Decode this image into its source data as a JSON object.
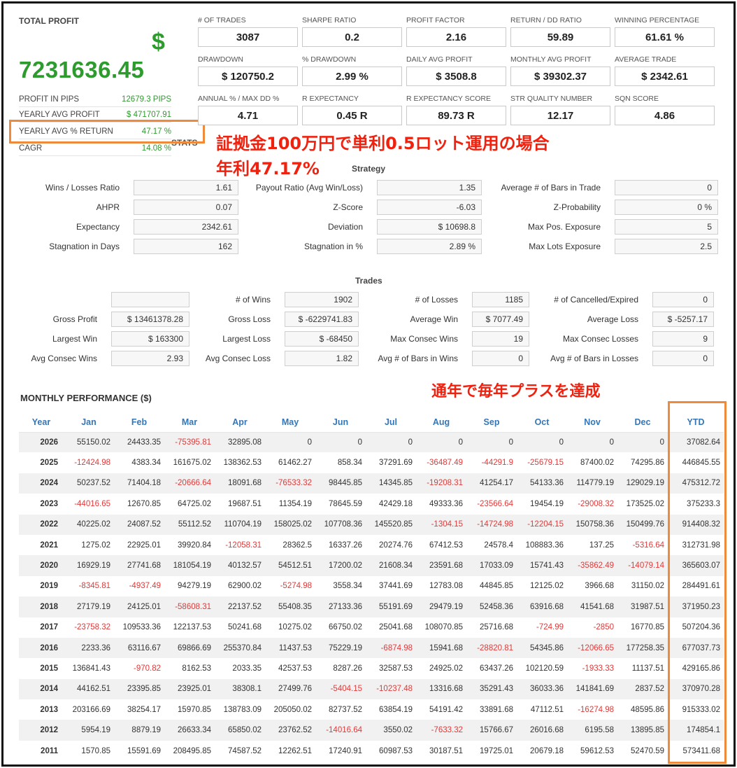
{
  "total_profit": {
    "title": "TOTAL PROFIT",
    "currency_symbol": "$",
    "value": "7231636.45",
    "rows": [
      {
        "label": "PROFIT IN PIPS",
        "value": "12679.3 PIPS"
      },
      {
        "label": "YEARLY AVG PROFIT",
        "value": "$ 471707.91"
      },
      {
        "label": "YEARLY AVG % RETURN",
        "value": "47.17 %"
      },
      {
        "label": "CAGR",
        "value": "14.08 %"
      }
    ]
  },
  "stats_grid": [
    {
      "label": "# OF TRADES",
      "value": "3087"
    },
    {
      "label": "SHARPE RATIO",
      "value": "0.2"
    },
    {
      "label": "PROFIT FACTOR",
      "value": "2.16"
    },
    {
      "label": "RETURN / DD RATIO",
      "value": "59.89"
    },
    {
      "label": "WINNING PERCENTAGE",
      "value": "61.61 %"
    },
    {
      "label": "DRAWDOWN",
      "value": "$ 120750.2"
    },
    {
      "label": "% DRAWDOWN",
      "value": "2.99 %"
    },
    {
      "label": "DAILY AVG PROFIT",
      "value": "$ 3508.8"
    },
    {
      "label": "MONTHLY AVG PROFIT",
      "value": "$ 39302.37"
    },
    {
      "label": "AVERAGE TRADE",
      "value": "$ 2342.61"
    },
    {
      "label": "ANNUAL % / MAX DD %",
      "value": "4.71"
    },
    {
      "label": "R EXPECTANCY",
      "value": "0.45 R"
    },
    {
      "label": "R EXPECTANCY SCORE",
      "value": "89.73 R"
    },
    {
      "label": "STR QUALITY NUMBER",
      "value": "12.17"
    },
    {
      "label": "SQN SCORE",
      "value": "4.86"
    }
  ],
  "annotations": {
    "line1": "証拠金100万円で単利0.5ロット運用の場合",
    "line2": "年利47.17%",
    "monthly_note": "通年で毎年プラスを達成",
    "stats_fragment": "STATS"
  },
  "strategy": {
    "title": "Strategy",
    "rows": [
      [
        {
          "label": "Wins / Losses Ratio",
          "value": "1.61"
        },
        {
          "label": "Payout Ratio (Avg Win/Loss)",
          "value": "1.35"
        },
        {
          "label": "Average # of Bars in Trade",
          "value": "0"
        }
      ],
      [
        {
          "label": "AHPR",
          "value": "0.07"
        },
        {
          "label": "Z-Score",
          "value": "-6.03"
        },
        {
          "label": "Z-Probability",
          "value": "0 %"
        }
      ],
      [
        {
          "label": "Expectancy",
          "value": "2342.61"
        },
        {
          "label": "Deviation",
          "value": "$ 10698.8"
        },
        {
          "label": "Max Pos. Exposure",
          "value": "5"
        }
      ],
      [
        {
          "label": "Stagnation in Days",
          "value": "162"
        },
        {
          "label": "Stagnation in %",
          "value": "2.89 %"
        },
        {
          "label": "Max Lots Exposure",
          "value": "2.5"
        }
      ]
    ]
  },
  "trades": {
    "title": "Trades",
    "rows": [
      [
        {
          "label": "",
          "value": ""
        },
        {
          "label": "# of Wins",
          "value": "1902"
        },
        {
          "label": "# of Losses",
          "value": "1185"
        },
        {
          "label": "# of Cancelled/Expired",
          "value": "0"
        }
      ],
      [
        {
          "label": "Gross Profit",
          "value": "$ 13461378.28"
        },
        {
          "label": "Gross Loss",
          "value": "$ -6229741.83"
        },
        {
          "label": "Average Win",
          "value": "$ 7077.49"
        },
        {
          "label": "Average Loss",
          "value": "$ -5257.17"
        }
      ],
      [
        {
          "label": "Largest Win",
          "value": "$ 163300"
        },
        {
          "label": "Largest Loss",
          "value": "$ -68450"
        },
        {
          "label": "Max Consec Wins",
          "value": "19"
        },
        {
          "label": "Max Consec Losses",
          "value": "9"
        }
      ],
      [
        {
          "label": "Avg Consec Wins",
          "value": "2.93"
        },
        {
          "label": "Avg Consec Loss",
          "value": "1.82"
        },
        {
          "label": "Avg # of Bars in Wins",
          "value": "0"
        },
        {
          "label": "Avg # of Bars in Losses",
          "value": "0"
        }
      ]
    ]
  },
  "monthly": {
    "title": "MONTHLY PERFORMANCE ($)",
    "headers": [
      "Year",
      "Jan",
      "Feb",
      "Mar",
      "Apr",
      "May",
      "Jun",
      "Jul",
      "Aug",
      "Sep",
      "Oct",
      "Nov",
      "Dec",
      "YTD"
    ],
    "rows": [
      [
        "2026",
        "55150.02",
        "24433.35",
        "-75395.81",
        "32895.08",
        "0",
        "0",
        "0",
        "0",
        "0",
        "0",
        "0",
        "0",
        "37082.64"
      ],
      [
        "2025",
        "-12424.98",
        "4383.34",
        "161675.02",
        "138362.53",
        "61462.27",
        "858.34",
        "37291.69",
        "-36487.49",
        "-44291.9",
        "-25679.15",
        "87400.02",
        "74295.86",
        "446845.55"
      ],
      [
        "2024",
        "50237.52",
        "71404.18",
        "-20666.64",
        "18091.68",
        "-76533.32",
        "98445.85",
        "14345.85",
        "-19208.31",
        "41254.17",
        "54133.36",
        "114779.19",
        "129029.19",
        "475312.72"
      ],
      [
        "2023",
        "-44016.65",
        "12670.85",
        "64725.02",
        "19687.51",
        "11354.19",
        "78645.59",
        "42429.18",
        "49333.36",
        "-23566.64",
        "19454.19",
        "-29008.32",
        "173525.02",
        "375233.3"
      ],
      [
        "2022",
        "40225.02",
        "24087.52",
        "55112.52",
        "110704.19",
        "158025.02",
        "107708.36",
        "145520.85",
        "-1304.15",
        "-14724.98",
        "-12204.15",
        "150758.36",
        "150499.76",
        "914408.32"
      ],
      [
        "2021",
        "1275.02",
        "22925.01",
        "39920.84",
        "-12058.31",
        "28362.5",
        "16337.26",
        "20274.76",
        "67412.53",
        "24578.4",
        "108883.36",
        "137.25",
        "-5316.64",
        "312731.98"
      ],
      [
        "2020",
        "16929.19",
        "27741.68",
        "181054.19",
        "40132.57",
        "54512.51",
        "17200.02",
        "21608.34",
        "23591.68",
        "17033.09",
        "15741.43",
        "-35862.49",
        "-14079.14",
        "365603.07"
      ],
      [
        "2019",
        "-8345.81",
        "-4937.49",
        "94279.19",
        "62900.02",
        "-5274.98",
        "3558.34",
        "37441.69",
        "12783.08",
        "44845.85",
        "12125.02",
        "3966.68",
        "31150.02",
        "284491.61"
      ],
      [
        "2018",
        "27179.19",
        "24125.01",
        "-58608.31",
        "22137.52",
        "55408.35",
        "27133.36",
        "55191.69",
        "29479.19",
        "52458.36",
        "63916.68",
        "41541.68",
        "31987.51",
        "371950.23"
      ],
      [
        "2017",
        "-23758.32",
        "109533.36",
        "122137.53",
        "50241.68",
        "10275.02",
        "66750.02",
        "25041.68",
        "108070.85",
        "25716.68",
        "-724.99",
        "-2850",
        "16770.85",
        "507204.36"
      ],
      [
        "2016",
        "2233.36",
        "63116.67",
        "69866.69",
        "255370.84",
        "11437.53",
        "75229.19",
        "-6874.98",
        "15941.68",
        "-28820.81",
        "54345.86",
        "-12066.65",
        "177258.35",
        "677037.73"
      ],
      [
        "2015",
        "136841.43",
        "-970.82",
        "8162.53",
        "2033.35",
        "42537.53",
        "8287.26",
        "32587.53",
        "24925.02",
        "63437.26",
        "102120.59",
        "-1933.33",
        "11137.51",
        "429165.86"
      ],
      [
        "2014",
        "44162.51",
        "23395.85",
        "23925.01",
        "38308.1",
        "27499.76",
        "-5404.15",
        "-10237.48",
        "13316.68",
        "35291.43",
        "36033.36",
        "141841.69",
        "2837.52",
        "370970.28"
      ],
      [
        "2013",
        "203166.69",
        "38254.17",
        "15970.85",
        "138783.09",
        "205050.02",
        "82737.52",
        "63854.19",
        "54191.42",
        "33891.68",
        "47112.51",
        "-16274.98",
        "48595.86",
        "915333.02"
      ],
      [
        "2012",
        "5954.19",
        "8879.19",
        "26633.34",
        "65850.02",
        "23762.52",
        "-14016.64",
        "3550.02",
        "-7633.32",
        "15766.67",
        "26016.68",
        "6195.58",
        "13895.85",
        "174854.1"
      ],
      [
        "2011",
        "1570.85",
        "15591.69",
        "208495.85",
        "74587.52",
        "12262.51",
        "17240.91",
        "60987.53",
        "30187.51",
        "19725.01",
        "20679.18",
        "59612.53",
        "52470.59",
        "573411.68"
      ]
    ]
  },
  "colors": {
    "positive": "#2e9b2e",
    "negative": "#e03a3a",
    "header": "#3576b6",
    "callout": "#f0220f",
    "highlight_box": "#ee8a3c"
  }
}
